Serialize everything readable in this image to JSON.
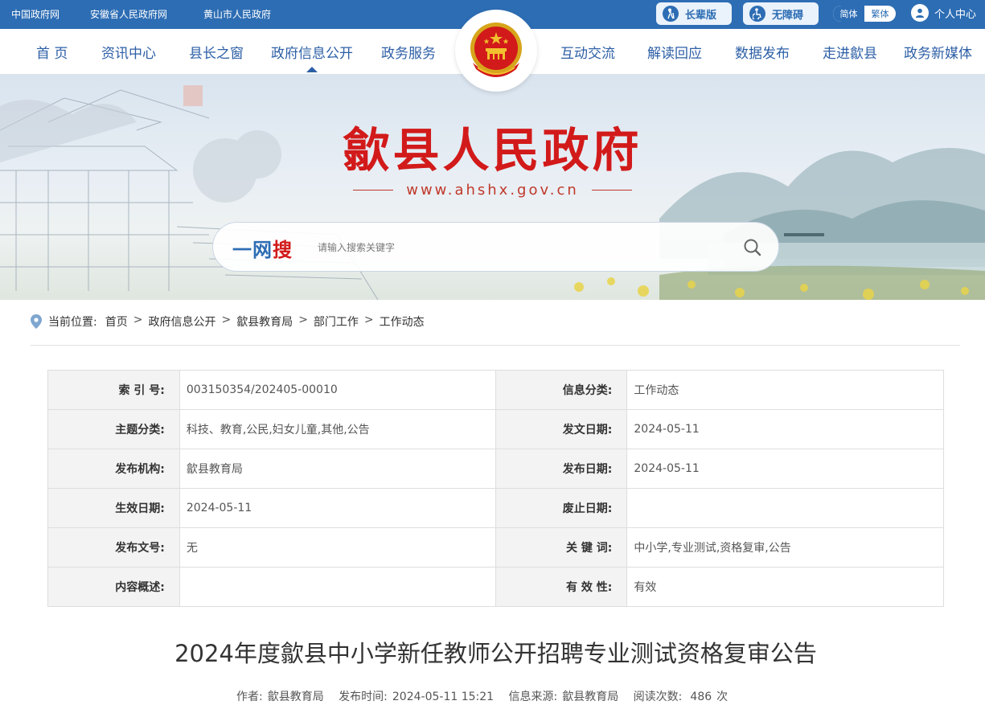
{
  "topbar": {
    "links": [
      "中国政府网",
      "安徽省人民政府网",
      "黄山市人民政府"
    ],
    "elder_label": "长辈版",
    "accessible_label": "无障碍",
    "lang_simplified": "简体",
    "lang_traditional": "繁体",
    "user_center": "个人中心",
    "bg_color": "#2d6db4"
  },
  "nav": {
    "items": [
      "首 页",
      "资讯中心",
      "县长之窗",
      "政府信息公开",
      "政务服务",
      "互动交流",
      "解读回应",
      "数据发布",
      "走进歙县",
      "政务新媒体"
    ],
    "active_index": 3
  },
  "banner": {
    "title": "歙县人民政府",
    "url": "www.ahshx.gov.cn",
    "search_brand_1": "一网",
    "search_brand_2": "搜",
    "search_placeholder": "请输入搜索关键字"
  },
  "breadcrumb": {
    "prefix": "当前位置:",
    "items": [
      "首页",
      "政府信息公开",
      "歙县教育局",
      "部门工作",
      "工作动态"
    ]
  },
  "info_table": [
    {
      "k1": "索 引 号:",
      "v1": "003150354/202405-00010",
      "k2": "信息分类:",
      "v2": "工作动态"
    },
    {
      "k1": "主题分类:",
      "v1": "科技、教育,公民,妇女儿童,其他,公告",
      "k2": "发文日期:",
      "v2": "2024-05-11"
    },
    {
      "k1": "发布机构:",
      "v1": "歙县教育局",
      "k2": "发布日期:",
      "v2": "2024-05-11"
    },
    {
      "k1": "生效日期:",
      "v1": "2024-05-11",
      "k2": "废止日期:",
      "v2": ""
    },
    {
      "k1": "发布文号:",
      "v1": "无",
      "k2": "关 键 词:",
      "v2": "中小学,专业测试,资格复审,公告"
    },
    {
      "k1": "内容概述:",
      "v1": "",
      "k2": "有 效 性:",
      "v2": "有效"
    }
  ],
  "article": {
    "title": "2024年度歙县中小学新任教师公开招聘专业测试资格复审公告",
    "author_label": "作者:",
    "author": "歙县教育局",
    "time_label": "发布时间:",
    "time": "2024-05-11 15:21",
    "source_label": "信息来源:",
    "source": "歙县教育局",
    "views_label": "阅读次数:",
    "views": "486",
    "views_unit": "次"
  },
  "colors": {
    "primary": "#2d6db4",
    "title_red": "#d21a1a"
  }
}
